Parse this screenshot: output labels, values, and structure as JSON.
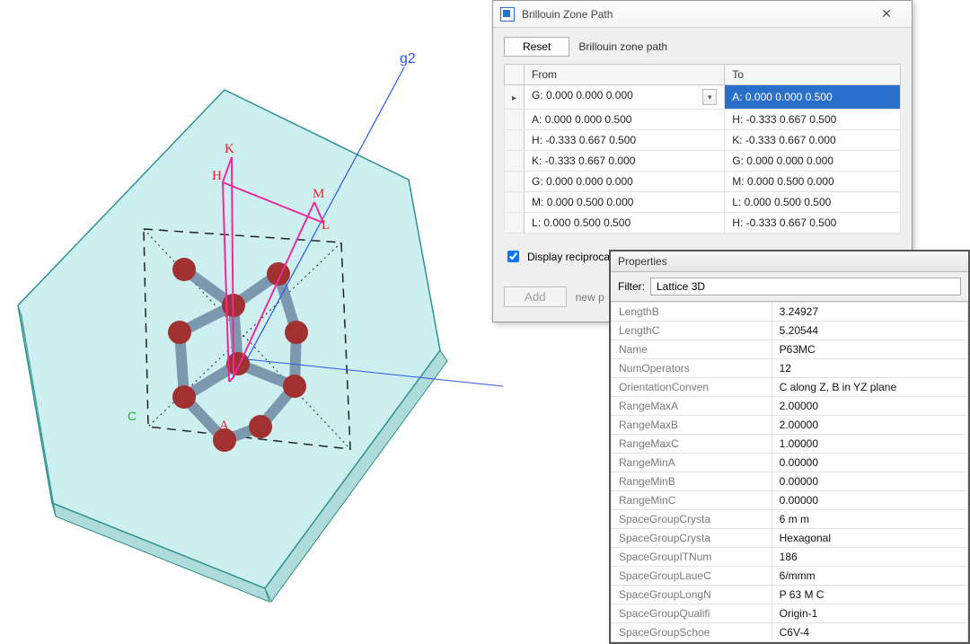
{
  "viewport": {
    "g2_label": "g2",
    "K": "K",
    "H": "H",
    "M": "M",
    "L": "L",
    "A": "A",
    "C": "C"
  },
  "bz": {
    "title": "Brillouin Zone Path",
    "reset_label": "Reset",
    "tool_label": "Brillouin zone path",
    "col_from": "From",
    "col_to": "To",
    "rows": [
      {
        "from": "G:  0.000  0.000  0.000",
        "to": "A:  0.000  0.000  0.500",
        "selected": true
      },
      {
        "from": "A:  0.000  0.000  0.500",
        "to": "H:  -0.333  0.667  0.500"
      },
      {
        "from": "H:  -0.333  0.667  0.500",
        "to": "K:  -0.333  0.667  0.000"
      },
      {
        "from": "K:  -0.333  0.667  0.000",
        "to": "G:  0.000  0.000  0.000"
      },
      {
        "from": "G:  0.000  0.000  0.000",
        "to": "M:  0.000  0.500  0.000"
      },
      {
        "from": "M:  0.000  0.500  0.000",
        "to": "L:  0.000  0.500  0.500"
      },
      {
        "from": "L:  0.000  0.500  0.500",
        "to": "H:  -0.333  0.667  0.500"
      }
    ],
    "checkbox_label": "Display reciprocal la",
    "add_label": "Add",
    "new_label": "new p"
  },
  "props": {
    "header": "Properties",
    "filter_label": "Filter:",
    "filter_value": "Lattice 3D",
    "items": [
      {
        "k": "LengthB",
        "v": "3.24927"
      },
      {
        "k": "LengthC",
        "v": "5.20544"
      },
      {
        "k": "Name",
        "v": "P63MC"
      },
      {
        "k": "NumOperators",
        "v": "12"
      },
      {
        "k": "OrientationConven",
        "v": "C along Z, B in YZ plane"
      },
      {
        "k": "RangeMaxA",
        "v": "2.00000"
      },
      {
        "k": "RangeMaxB",
        "v": "2.00000"
      },
      {
        "k": "RangeMaxC",
        "v": "1.00000"
      },
      {
        "k": "RangeMinA",
        "v": "0.00000"
      },
      {
        "k": "RangeMinB",
        "v": "0.00000"
      },
      {
        "k": "RangeMinC",
        "v": "0.00000"
      },
      {
        "k": "SpaceGroupCrysta",
        "v": "6 m m"
      },
      {
        "k": "SpaceGroupCrysta",
        "v": "Hexagonal"
      },
      {
        "k": "SpaceGroupITNum",
        "v": "186"
      },
      {
        "k": "SpaceGroupLaueC",
        "v": "6/mmm"
      },
      {
        "k": "SpaceGroupLongN",
        "v": "P 63 M C"
      },
      {
        "k": "SpaceGroupQualifi",
        "v": "Origin-1"
      },
      {
        "k": "SpaceGroupSchoe",
        "v": "C6V-4"
      }
    ]
  }
}
